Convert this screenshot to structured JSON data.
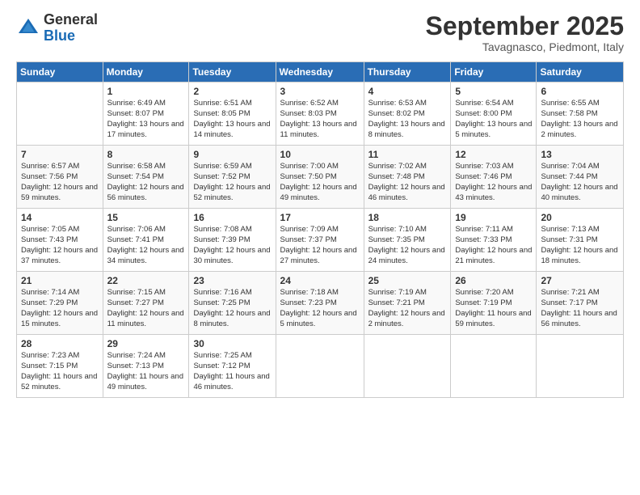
{
  "logo": {
    "general": "General",
    "blue": "Blue"
  },
  "title": "September 2025",
  "location": "Tavagnasco, Piedmont, Italy",
  "days_of_week": [
    "Sunday",
    "Monday",
    "Tuesday",
    "Wednesday",
    "Thursday",
    "Friday",
    "Saturday"
  ],
  "weeks": [
    [
      {
        "day": "",
        "sunrise": "",
        "sunset": "",
        "daylight": ""
      },
      {
        "day": "1",
        "sunrise": "Sunrise: 6:49 AM",
        "sunset": "Sunset: 8:07 PM",
        "daylight": "Daylight: 13 hours and 17 minutes."
      },
      {
        "day": "2",
        "sunrise": "Sunrise: 6:51 AM",
        "sunset": "Sunset: 8:05 PM",
        "daylight": "Daylight: 13 hours and 14 minutes."
      },
      {
        "day": "3",
        "sunrise": "Sunrise: 6:52 AM",
        "sunset": "Sunset: 8:03 PM",
        "daylight": "Daylight: 13 hours and 11 minutes."
      },
      {
        "day": "4",
        "sunrise": "Sunrise: 6:53 AM",
        "sunset": "Sunset: 8:02 PM",
        "daylight": "Daylight: 13 hours and 8 minutes."
      },
      {
        "day": "5",
        "sunrise": "Sunrise: 6:54 AM",
        "sunset": "Sunset: 8:00 PM",
        "daylight": "Daylight: 13 hours and 5 minutes."
      },
      {
        "day": "6",
        "sunrise": "Sunrise: 6:55 AM",
        "sunset": "Sunset: 7:58 PM",
        "daylight": "Daylight: 13 hours and 2 minutes."
      }
    ],
    [
      {
        "day": "7",
        "sunrise": "Sunrise: 6:57 AM",
        "sunset": "Sunset: 7:56 PM",
        "daylight": "Daylight: 12 hours and 59 minutes."
      },
      {
        "day": "8",
        "sunrise": "Sunrise: 6:58 AM",
        "sunset": "Sunset: 7:54 PM",
        "daylight": "Daylight: 12 hours and 56 minutes."
      },
      {
        "day": "9",
        "sunrise": "Sunrise: 6:59 AM",
        "sunset": "Sunset: 7:52 PM",
        "daylight": "Daylight: 12 hours and 52 minutes."
      },
      {
        "day": "10",
        "sunrise": "Sunrise: 7:00 AM",
        "sunset": "Sunset: 7:50 PM",
        "daylight": "Daylight: 12 hours and 49 minutes."
      },
      {
        "day": "11",
        "sunrise": "Sunrise: 7:02 AM",
        "sunset": "Sunset: 7:48 PM",
        "daylight": "Daylight: 12 hours and 46 minutes."
      },
      {
        "day": "12",
        "sunrise": "Sunrise: 7:03 AM",
        "sunset": "Sunset: 7:46 PM",
        "daylight": "Daylight: 12 hours and 43 minutes."
      },
      {
        "day": "13",
        "sunrise": "Sunrise: 7:04 AM",
        "sunset": "Sunset: 7:44 PM",
        "daylight": "Daylight: 12 hours and 40 minutes."
      }
    ],
    [
      {
        "day": "14",
        "sunrise": "Sunrise: 7:05 AM",
        "sunset": "Sunset: 7:43 PM",
        "daylight": "Daylight: 12 hours and 37 minutes."
      },
      {
        "day": "15",
        "sunrise": "Sunrise: 7:06 AM",
        "sunset": "Sunset: 7:41 PM",
        "daylight": "Daylight: 12 hours and 34 minutes."
      },
      {
        "day": "16",
        "sunrise": "Sunrise: 7:08 AM",
        "sunset": "Sunset: 7:39 PM",
        "daylight": "Daylight: 12 hours and 30 minutes."
      },
      {
        "day": "17",
        "sunrise": "Sunrise: 7:09 AM",
        "sunset": "Sunset: 7:37 PM",
        "daylight": "Daylight: 12 hours and 27 minutes."
      },
      {
        "day": "18",
        "sunrise": "Sunrise: 7:10 AM",
        "sunset": "Sunset: 7:35 PM",
        "daylight": "Daylight: 12 hours and 24 minutes."
      },
      {
        "day": "19",
        "sunrise": "Sunrise: 7:11 AM",
        "sunset": "Sunset: 7:33 PM",
        "daylight": "Daylight: 12 hours and 21 minutes."
      },
      {
        "day": "20",
        "sunrise": "Sunrise: 7:13 AM",
        "sunset": "Sunset: 7:31 PM",
        "daylight": "Daylight: 12 hours and 18 minutes."
      }
    ],
    [
      {
        "day": "21",
        "sunrise": "Sunrise: 7:14 AM",
        "sunset": "Sunset: 7:29 PM",
        "daylight": "Daylight: 12 hours and 15 minutes."
      },
      {
        "day": "22",
        "sunrise": "Sunrise: 7:15 AM",
        "sunset": "Sunset: 7:27 PM",
        "daylight": "Daylight: 12 hours and 11 minutes."
      },
      {
        "day": "23",
        "sunrise": "Sunrise: 7:16 AM",
        "sunset": "Sunset: 7:25 PM",
        "daylight": "Daylight: 12 hours and 8 minutes."
      },
      {
        "day": "24",
        "sunrise": "Sunrise: 7:18 AM",
        "sunset": "Sunset: 7:23 PM",
        "daylight": "Daylight: 12 hours and 5 minutes."
      },
      {
        "day": "25",
        "sunrise": "Sunrise: 7:19 AM",
        "sunset": "Sunset: 7:21 PM",
        "daylight": "Daylight: 12 hours and 2 minutes."
      },
      {
        "day": "26",
        "sunrise": "Sunrise: 7:20 AM",
        "sunset": "Sunset: 7:19 PM",
        "daylight": "Daylight: 11 hours and 59 minutes."
      },
      {
        "day": "27",
        "sunrise": "Sunrise: 7:21 AM",
        "sunset": "Sunset: 7:17 PM",
        "daylight": "Daylight: 11 hours and 56 minutes."
      }
    ],
    [
      {
        "day": "28",
        "sunrise": "Sunrise: 7:23 AM",
        "sunset": "Sunset: 7:15 PM",
        "daylight": "Daylight: 11 hours and 52 minutes."
      },
      {
        "day": "29",
        "sunrise": "Sunrise: 7:24 AM",
        "sunset": "Sunset: 7:13 PM",
        "daylight": "Daylight: 11 hours and 49 minutes."
      },
      {
        "day": "30",
        "sunrise": "Sunrise: 7:25 AM",
        "sunset": "Sunset: 7:12 PM",
        "daylight": "Daylight: 11 hours and 46 minutes."
      },
      {
        "day": "",
        "sunrise": "",
        "sunset": "",
        "daylight": ""
      },
      {
        "day": "",
        "sunrise": "",
        "sunset": "",
        "daylight": ""
      },
      {
        "day": "",
        "sunrise": "",
        "sunset": "",
        "daylight": ""
      },
      {
        "day": "",
        "sunrise": "",
        "sunset": "",
        "daylight": ""
      }
    ]
  ]
}
